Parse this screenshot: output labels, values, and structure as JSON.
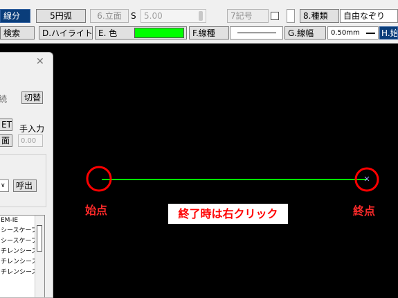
{
  "toolbar": {
    "row1": {
      "line_segment": "線分",
      "arc5": "5円弧",
      "elevation6": "6.立面",
      "s_label": "S",
      "s_value": "5.00",
      "symbol7": "7記号",
      "type8": "8.種類",
      "type_value": "自由なぞり"
    },
    "row2": {
      "search": "検索",
      "highlight": "D.ハイライト",
      "color_label": "E. 色",
      "color_value": "#00ff00",
      "line_type_label": "F.線種",
      "line_width_label": "G.線幅",
      "line_width_value": "0.50mm",
      "h_button": "H.始"
    }
  },
  "panel": {
    "continue_text": "続",
    "switch_button": "切替",
    "et_button": "ET",
    "manual_input": "手入力",
    "face_button": "面",
    "manual_value": "0.00",
    "call_button": "呼出",
    "list_items": [
      "EM-IE",
      "シースケーブ",
      "シースケーブ",
      "チレンシース",
      "チレンシース",
      "チレンシース"
    ]
  },
  "canvas": {
    "start_label": "始点",
    "end_label": "終点",
    "note": "終了時は右クリック",
    "line_color": "#00ff00",
    "marker_color": "#ff0000"
  }
}
